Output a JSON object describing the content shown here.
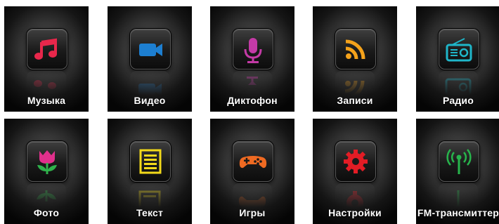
{
  "menu": {
    "row1": [
      {
        "label": "Музыка",
        "icon": "music-note-icon",
        "color": "#e8274b"
      },
      {
        "label": "Видео",
        "icon": "video-camera-icon",
        "color": "#1d7fd1"
      },
      {
        "label": "Диктофон",
        "icon": "microphone-icon",
        "color": "#c43aa6"
      },
      {
        "label": "Записи",
        "icon": "rss-feed-icon",
        "color": "#f4a21b"
      },
      {
        "label": "Радио",
        "icon": "radio-icon",
        "color": "#1fb6c9"
      }
    ],
    "row2": [
      {
        "label": "Фото",
        "icon": "flower-icon",
        "color": "#e0308c"
      },
      {
        "label": "Текст",
        "icon": "text-document-icon",
        "color": "#f2d91a"
      },
      {
        "label": "Игры",
        "icon": "gamepad-icon",
        "color": "#ef6a22"
      },
      {
        "label": "Настройки",
        "icon": "gear-icon",
        "color": "#e31c25"
      },
      {
        "label": "FM-трансмиттер",
        "icon": "antenna-icon",
        "color": "#27b54c"
      }
    ]
  }
}
